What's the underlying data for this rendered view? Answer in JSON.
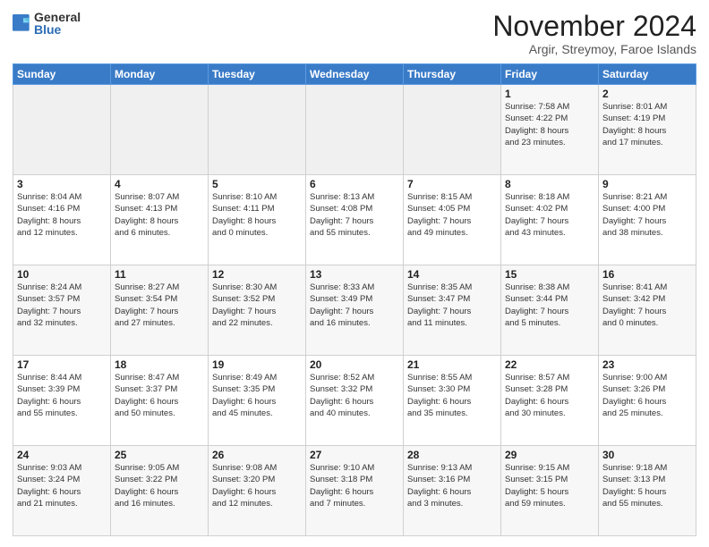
{
  "logo": {
    "general": "General",
    "blue": "Blue"
  },
  "title": "November 2024",
  "subtitle": "Argir, Streymoy, Faroe Islands",
  "days_of_week": [
    "Sunday",
    "Monday",
    "Tuesday",
    "Wednesday",
    "Thursday",
    "Friday",
    "Saturday"
  ],
  "weeks": [
    [
      {
        "day": "",
        "info": ""
      },
      {
        "day": "",
        "info": ""
      },
      {
        "day": "",
        "info": ""
      },
      {
        "day": "",
        "info": ""
      },
      {
        "day": "",
        "info": ""
      },
      {
        "day": "1",
        "info": "Sunrise: 7:58 AM\nSunset: 4:22 PM\nDaylight: 8 hours\nand 23 minutes."
      },
      {
        "day": "2",
        "info": "Sunrise: 8:01 AM\nSunset: 4:19 PM\nDaylight: 8 hours\nand 17 minutes."
      }
    ],
    [
      {
        "day": "3",
        "info": "Sunrise: 8:04 AM\nSunset: 4:16 PM\nDaylight: 8 hours\nand 12 minutes."
      },
      {
        "day": "4",
        "info": "Sunrise: 8:07 AM\nSunset: 4:13 PM\nDaylight: 8 hours\nand 6 minutes."
      },
      {
        "day": "5",
        "info": "Sunrise: 8:10 AM\nSunset: 4:11 PM\nDaylight: 8 hours\nand 0 minutes."
      },
      {
        "day": "6",
        "info": "Sunrise: 8:13 AM\nSunset: 4:08 PM\nDaylight: 7 hours\nand 55 minutes."
      },
      {
        "day": "7",
        "info": "Sunrise: 8:15 AM\nSunset: 4:05 PM\nDaylight: 7 hours\nand 49 minutes."
      },
      {
        "day": "8",
        "info": "Sunrise: 8:18 AM\nSunset: 4:02 PM\nDaylight: 7 hours\nand 43 minutes."
      },
      {
        "day": "9",
        "info": "Sunrise: 8:21 AM\nSunset: 4:00 PM\nDaylight: 7 hours\nand 38 minutes."
      }
    ],
    [
      {
        "day": "10",
        "info": "Sunrise: 8:24 AM\nSunset: 3:57 PM\nDaylight: 7 hours\nand 32 minutes."
      },
      {
        "day": "11",
        "info": "Sunrise: 8:27 AM\nSunset: 3:54 PM\nDaylight: 7 hours\nand 27 minutes."
      },
      {
        "day": "12",
        "info": "Sunrise: 8:30 AM\nSunset: 3:52 PM\nDaylight: 7 hours\nand 22 minutes."
      },
      {
        "day": "13",
        "info": "Sunrise: 8:33 AM\nSunset: 3:49 PM\nDaylight: 7 hours\nand 16 minutes."
      },
      {
        "day": "14",
        "info": "Sunrise: 8:35 AM\nSunset: 3:47 PM\nDaylight: 7 hours\nand 11 minutes."
      },
      {
        "day": "15",
        "info": "Sunrise: 8:38 AM\nSunset: 3:44 PM\nDaylight: 7 hours\nand 5 minutes."
      },
      {
        "day": "16",
        "info": "Sunrise: 8:41 AM\nSunset: 3:42 PM\nDaylight: 7 hours\nand 0 minutes."
      }
    ],
    [
      {
        "day": "17",
        "info": "Sunrise: 8:44 AM\nSunset: 3:39 PM\nDaylight: 6 hours\nand 55 minutes."
      },
      {
        "day": "18",
        "info": "Sunrise: 8:47 AM\nSunset: 3:37 PM\nDaylight: 6 hours\nand 50 minutes."
      },
      {
        "day": "19",
        "info": "Sunrise: 8:49 AM\nSunset: 3:35 PM\nDaylight: 6 hours\nand 45 minutes."
      },
      {
        "day": "20",
        "info": "Sunrise: 8:52 AM\nSunset: 3:32 PM\nDaylight: 6 hours\nand 40 minutes."
      },
      {
        "day": "21",
        "info": "Sunrise: 8:55 AM\nSunset: 3:30 PM\nDaylight: 6 hours\nand 35 minutes."
      },
      {
        "day": "22",
        "info": "Sunrise: 8:57 AM\nSunset: 3:28 PM\nDaylight: 6 hours\nand 30 minutes."
      },
      {
        "day": "23",
        "info": "Sunrise: 9:00 AM\nSunset: 3:26 PM\nDaylight: 6 hours\nand 25 minutes."
      }
    ],
    [
      {
        "day": "24",
        "info": "Sunrise: 9:03 AM\nSunset: 3:24 PM\nDaylight: 6 hours\nand 21 minutes."
      },
      {
        "day": "25",
        "info": "Sunrise: 9:05 AM\nSunset: 3:22 PM\nDaylight: 6 hours\nand 16 minutes."
      },
      {
        "day": "26",
        "info": "Sunrise: 9:08 AM\nSunset: 3:20 PM\nDaylight: 6 hours\nand 12 minutes."
      },
      {
        "day": "27",
        "info": "Sunrise: 9:10 AM\nSunset: 3:18 PM\nDaylight: 6 hours\nand 7 minutes."
      },
      {
        "day": "28",
        "info": "Sunrise: 9:13 AM\nSunset: 3:16 PM\nDaylight: 6 hours\nand 3 minutes."
      },
      {
        "day": "29",
        "info": "Sunrise: 9:15 AM\nSunset: 3:15 PM\nDaylight: 5 hours\nand 59 minutes."
      },
      {
        "day": "30",
        "info": "Sunrise: 9:18 AM\nSunset: 3:13 PM\nDaylight: 5 hours\nand 55 minutes."
      }
    ]
  ]
}
